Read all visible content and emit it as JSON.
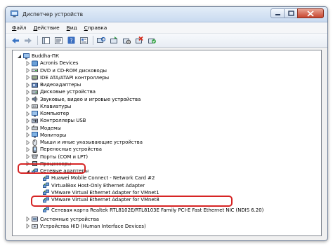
{
  "window": {
    "title": "Диспетчер устройств"
  },
  "menu": [
    {
      "label": "Файл",
      "underline": "Ф",
      "rest": "айл"
    },
    {
      "label": "Действие",
      "underline": "Д",
      "rest": "ействие"
    },
    {
      "label": "Вид",
      "underline": "В",
      "rest": "ид"
    },
    {
      "label": "Справка",
      "underline": "С",
      "rest": "правка"
    }
  ],
  "toolbar": [
    "back-icon",
    "forward-icon",
    "show-hide-console-icon",
    "properties-icon",
    "help-icon",
    "scan-hardware-icon",
    "update-driver-icon",
    "disable-device-icon",
    "uninstall-device-icon",
    "enable-device-icon"
  ],
  "tree": {
    "root": "Buddha-ПК",
    "categories": [
      {
        "label": "Acronis Devices",
        "icon": "acronis-icon"
      },
      {
        "label": "DVD и CD-ROM дисководы",
        "icon": "dvd-drive-icon"
      },
      {
        "label": "IDE ATA/ATAPI контроллеры",
        "icon": "ide-controller-icon"
      },
      {
        "label": "Видеоадаптеры",
        "icon": "display-adapter-icon"
      },
      {
        "label": "Дисковые устройства",
        "icon": "disk-drive-icon"
      },
      {
        "label": "Звуковые, видео и игровые устройства",
        "icon": "sound-icon"
      },
      {
        "label": "Клавиатуры",
        "icon": "keyboard-icon"
      },
      {
        "label": "Компьютер",
        "icon": "computer-icon"
      },
      {
        "label": "Контроллеры USB",
        "icon": "usb-icon"
      },
      {
        "label": "Модемы",
        "icon": "modem-icon"
      },
      {
        "label": "Мониторы",
        "icon": "monitor-icon"
      },
      {
        "label": "Мыши и иные указывающие устройства",
        "icon": "mouse-icon"
      },
      {
        "label": "Переносные устройства",
        "icon": "portable-device-icon"
      },
      {
        "label": "Порты (COM и LPT)",
        "icon": "port-icon"
      },
      {
        "label": "Процессоры",
        "icon": "processor-icon"
      }
    ],
    "network": {
      "label": "Сетевые адаптеры",
      "children": [
        "Huawei Mobile Connect - Network Card #2",
        "VirtualBox Host-Only Ethernet Adapter",
        "VMware Virtual Ethernet Adapter for VMnet1",
        "VMware Virtual Ethernet Adapter for VMnet8",
        "Сетевая карта Realtek RTL8102E/RTL8103E Family PCI-E Fast Ethernet NIC (NDIS 6.20)"
      ]
    },
    "after": [
      {
        "label": "Системные устройства",
        "icon": "system-device-icon"
      },
      {
        "label": "Устройства HID (Human Interface Devices)",
        "icon": "hid-icon"
      }
    ]
  },
  "colors": {
    "highlight": "#d62424",
    "selection": "#e6f0fa",
    "titlebar": "#c9daf0"
  }
}
